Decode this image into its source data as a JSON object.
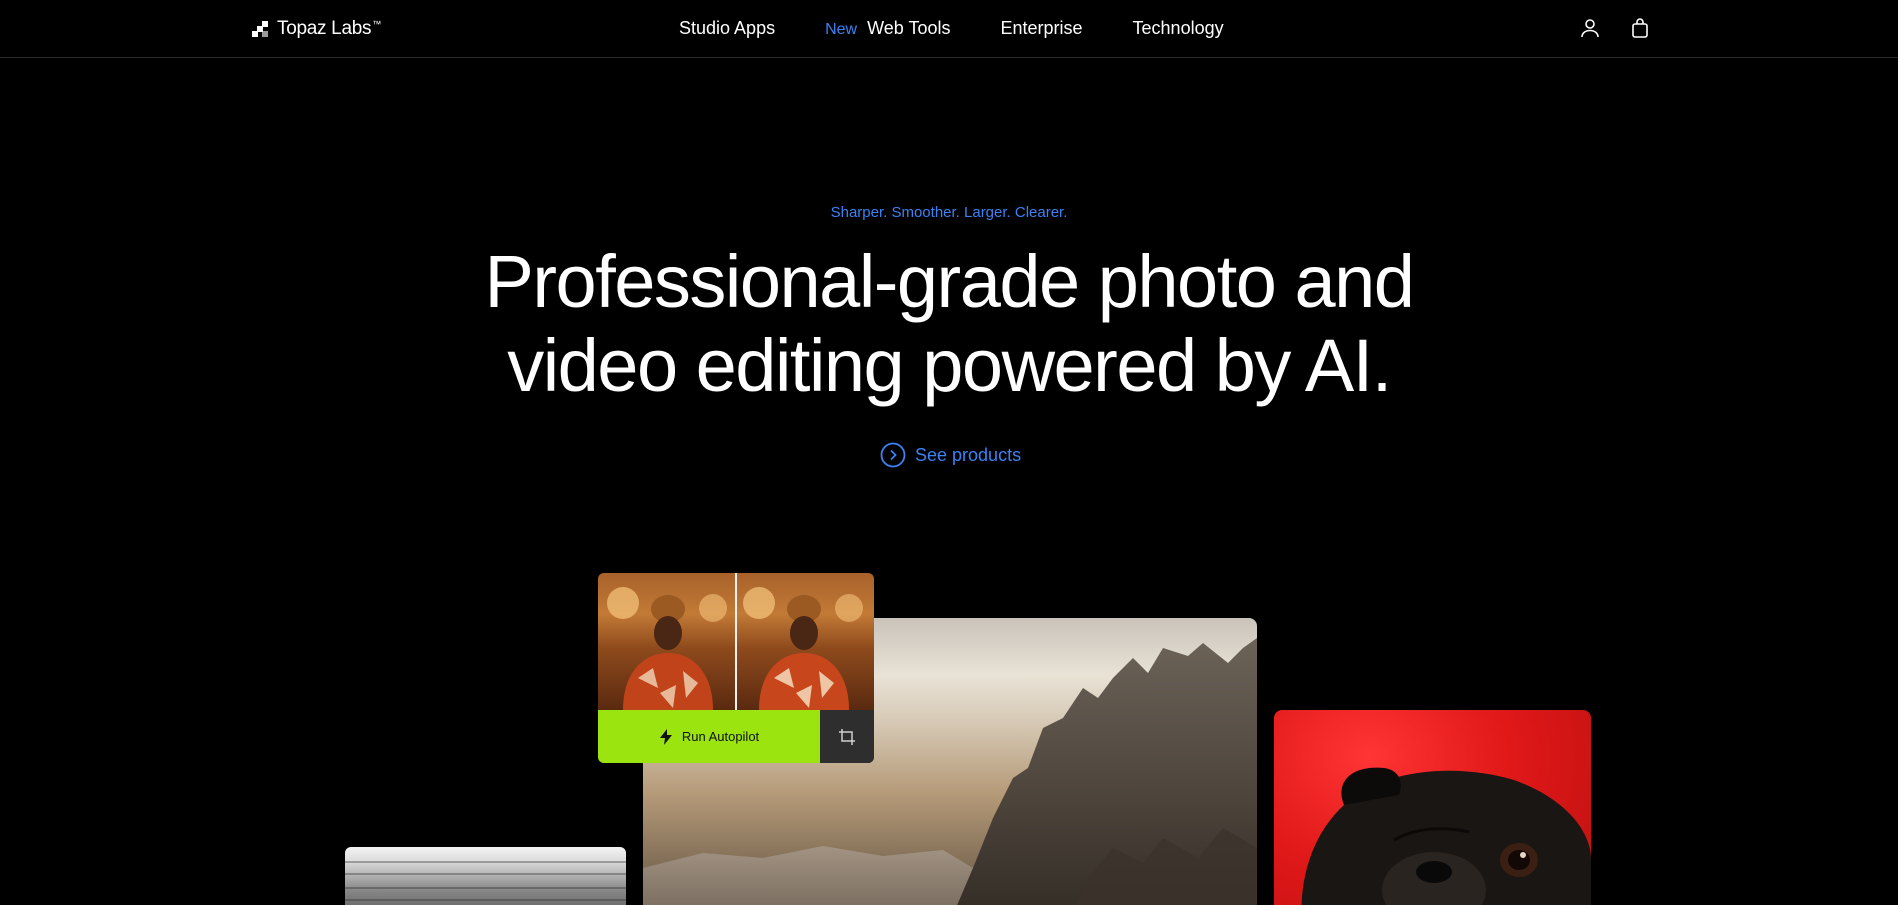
{
  "brand": {
    "name": "Topaz Labs",
    "trademark": "™"
  },
  "nav": {
    "links": [
      {
        "label": "Studio Apps"
      },
      {
        "badge": "New",
        "label": "Web Tools"
      },
      {
        "label": "Enterprise"
      },
      {
        "label": "Technology"
      }
    ],
    "icons": [
      "user-icon",
      "shopping-bag-icon"
    ]
  },
  "hero": {
    "tagline": "Sharper. Smoother. Larger. Clearer.",
    "headline_line1": "Professional-grade photo and",
    "headline_line2": "video editing powered by AI.",
    "cta_label": "See products",
    "cta_icon": "chevron-circle-right-icon"
  },
  "autopilot_card": {
    "button_label": "Run Autopilot",
    "button_icon": "lightning-bolt-icon",
    "tool_icon": "crop-icon",
    "button_color": "#9be40f"
  },
  "colors": {
    "accent": "#3b82f6",
    "background": "#000000",
    "text": "#ffffff"
  }
}
